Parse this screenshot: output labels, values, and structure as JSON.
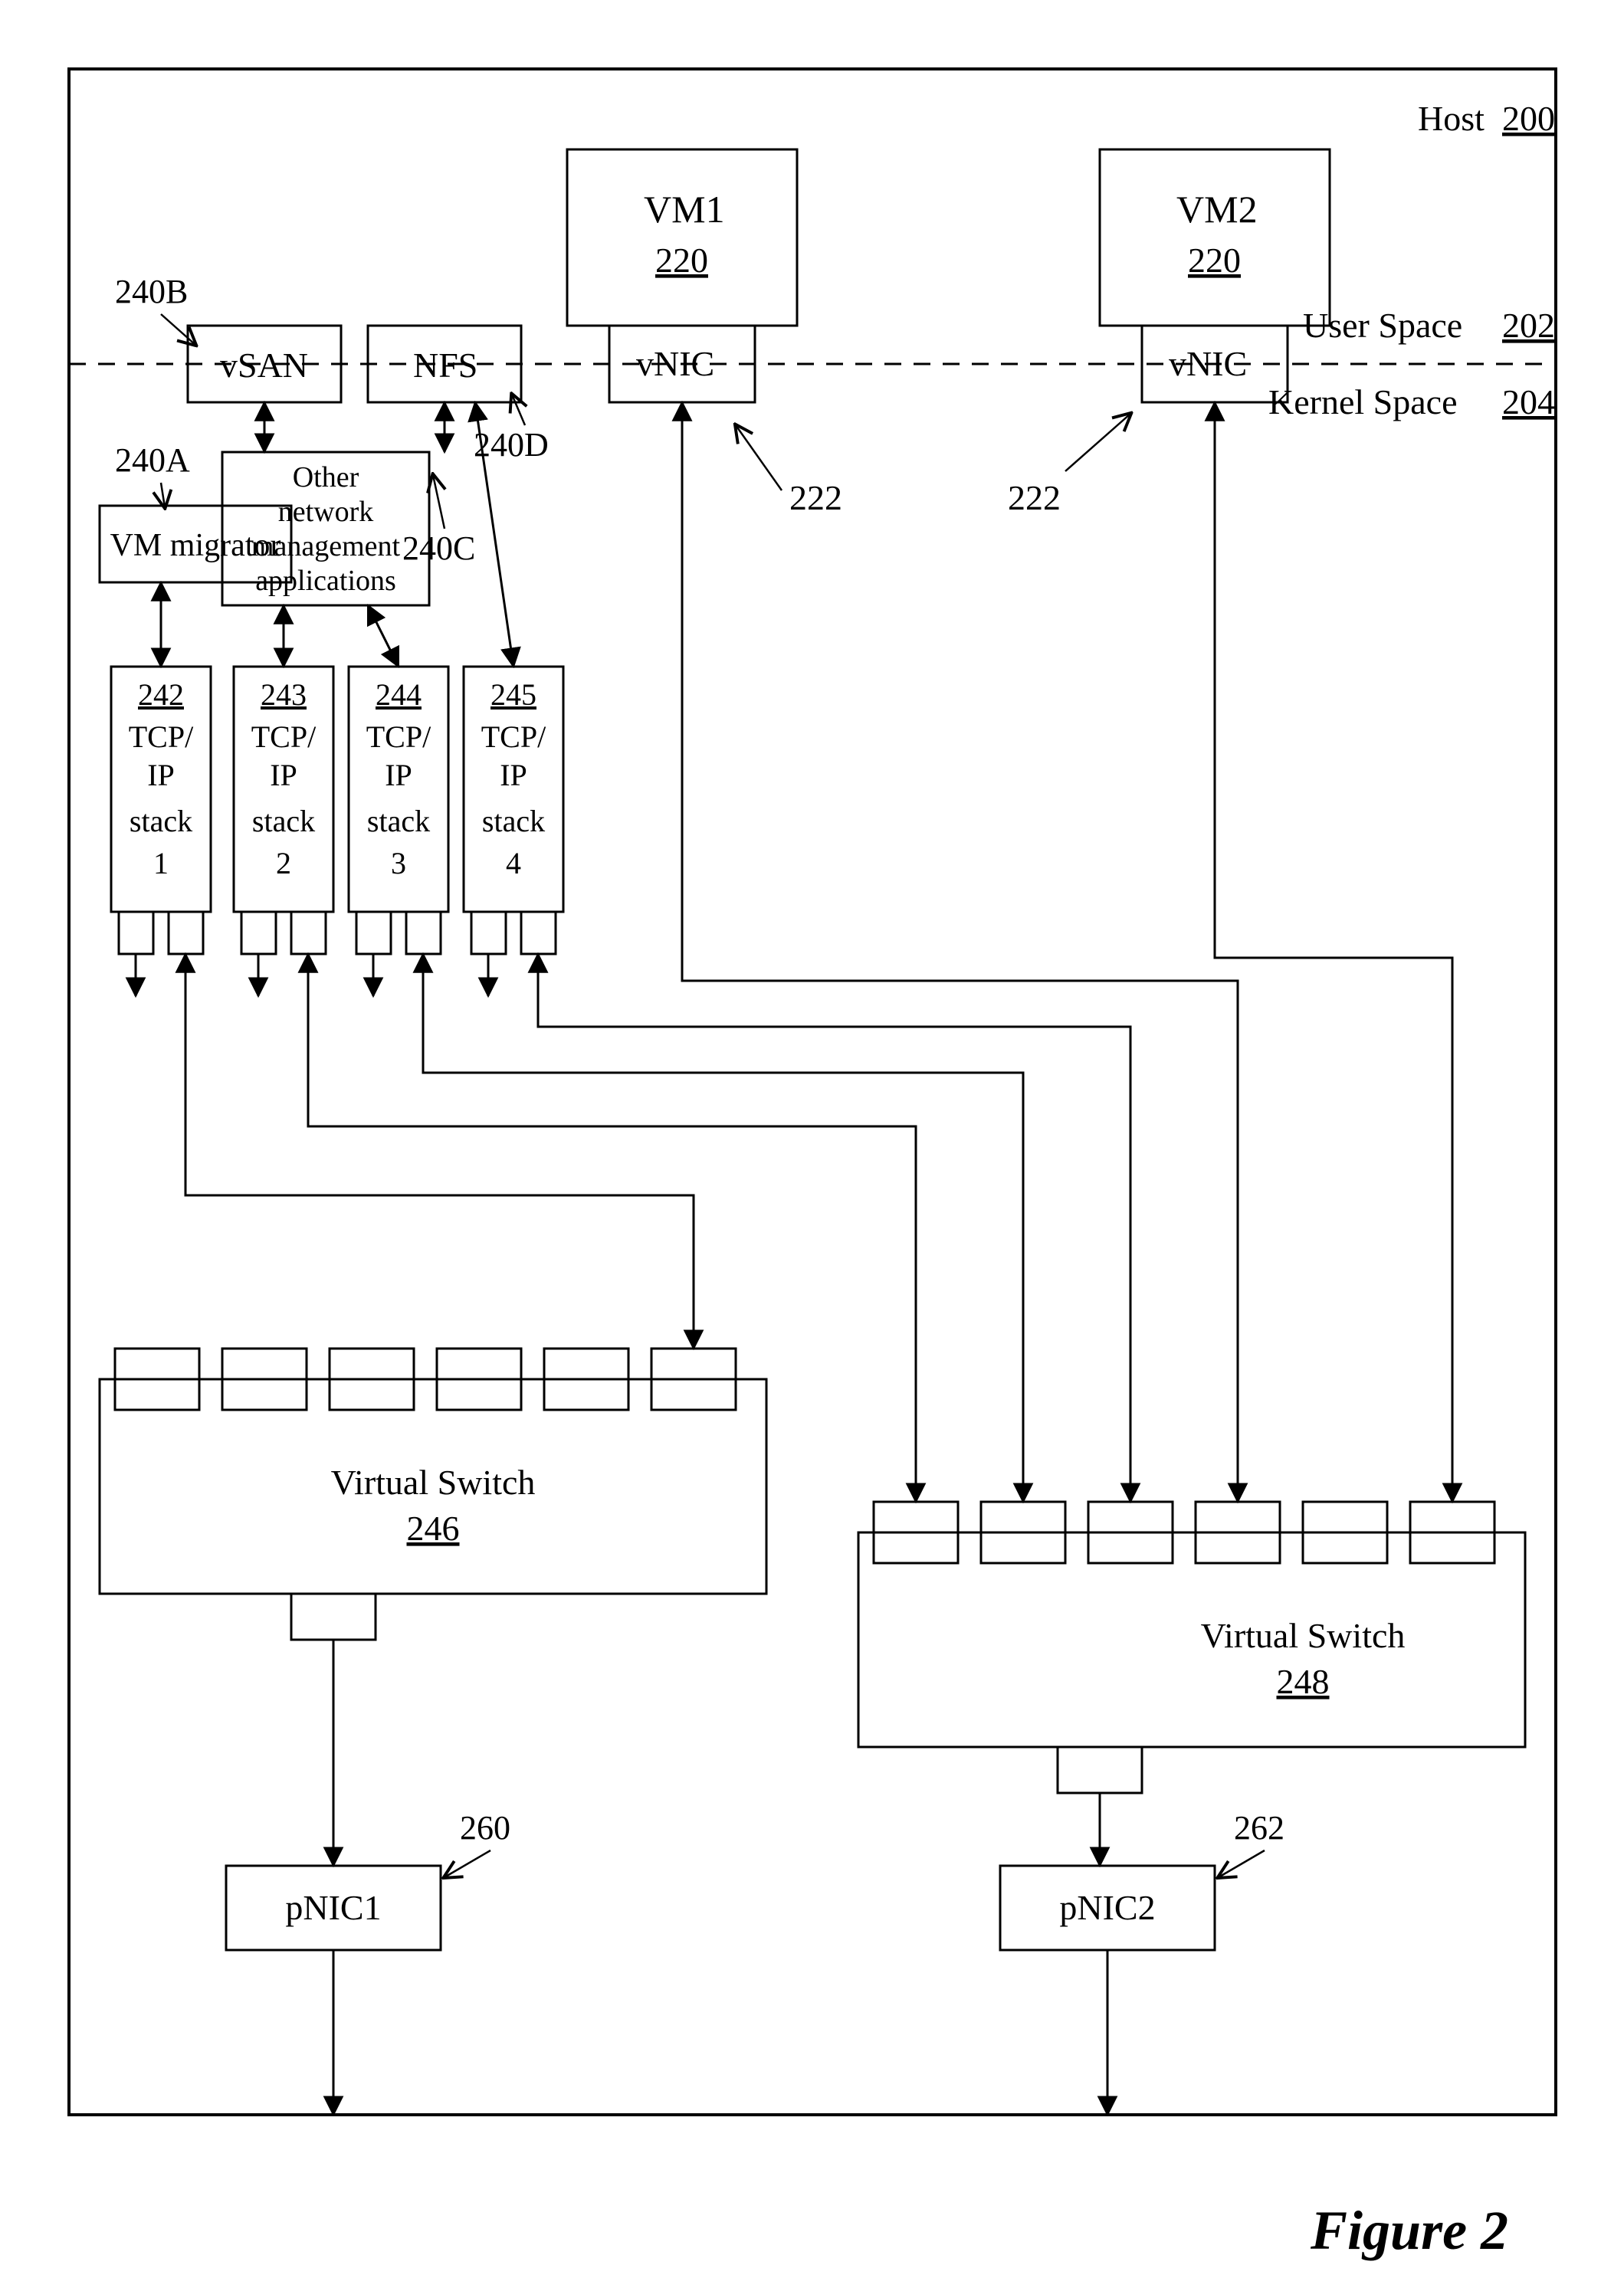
{
  "figure_caption": "Figure 2",
  "host": {
    "label": "Host",
    "ref": "200"
  },
  "user_space": {
    "label": "User Space",
    "ref": "202"
  },
  "kernel_space": {
    "label": "Kernel Space",
    "ref": "204"
  },
  "vm1": {
    "label": "VM1",
    "ref": "220",
    "vnic_label": "vNIC",
    "vnic_ref": "222"
  },
  "vm2": {
    "label": "VM2",
    "ref": "220",
    "vnic_label": "vNIC",
    "vnic_ref": "222"
  },
  "mgmt": {
    "vm_migrator": {
      "label": "VM migrator",
      "ref": "240A"
    },
    "vsan": {
      "label": "vSAN",
      "ref": "240B"
    },
    "other": {
      "label_l1": "Other",
      "label_l2": "network",
      "label_l3": "management",
      "label_l4": "applications",
      "ref": "240C"
    },
    "nfs": {
      "label": "NFS",
      "ref": "240D"
    }
  },
  "stacks": {
    "s1": {
      "ref": "242",
      "l1": "TCP/",
      "l2": "IP",
      "l3": "stack",
      "l4": "1"
    },
    "s2": {
      "ref": "243",
      "l1": "TCP/",
      "l2": "IP",
      "l3": "stack",
      "l4": "2"
    },
    "s3": {
      "ref": "244",
      "l1": "TCP/",
      "l2": "IP",
      "l3": "stack",
      "l4": "3"
    },
    "s4": {
      "ref": "245",
      "l1": "TCP/",
      "l2": "IP",
      "l3": "stack",
      "l4": "4"
    }
  },
  "vswitch1": {
    "label": "Virtual Switch",
    "ref": "246"
  },
  "vswitch2": {
    "label": "Virtual Switch",
    "ref": "248"
  },
  "pnic1": {
    "label": "pNIC1",
    "ref": "260"
  },
  "pnic2": {
    "label": "pNIC2",
    "ref": "262"
  }
}
